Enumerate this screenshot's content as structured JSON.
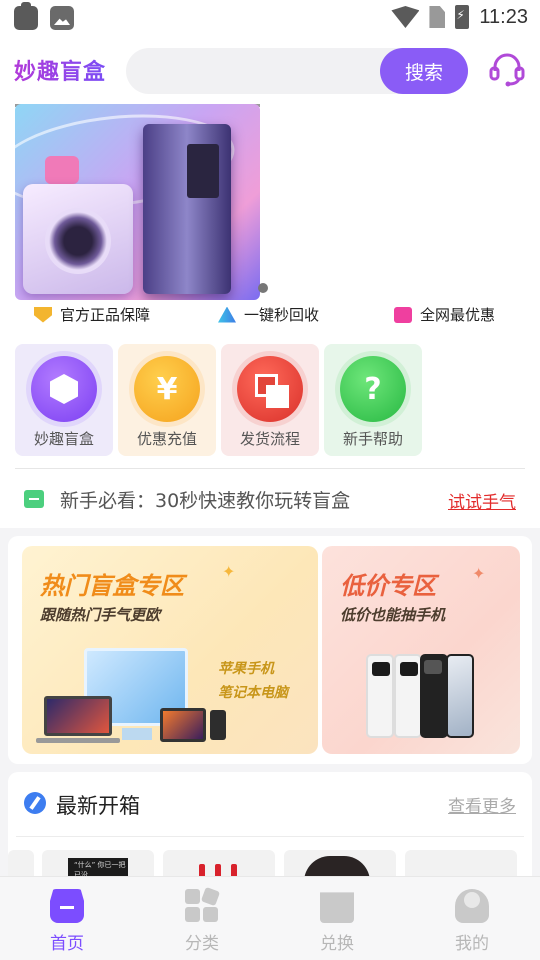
{
  "status_bar": {
    "time": "11:23"
  },
  "header": {
    "logo": "妙趣盲盒",
    "search": {
      "placeholder": "",
      "button_label": "搜索"
    }
  },
  "features": [
    "官方正品保障",
    "一键秒回收",
    "全网最优惠"
  ],
  "shortcuts": [
    {
      "label": "妙趣盲盒",
      "icon": "cube-icon",
      "glyph": ""
    },
    {
      "label": "优惠充值",
      "icon": "yen-icon",
      "glyph": "¥"
    },
    {
      "label": "发货流程",
      "icon": "squares-icon",
      "glyph": ""
    },
    {
      "label": "新手帮助",
      "icon": "question-icon",
      "glyph": "?"
    }
  ],
  "notice": {
    "text": "新手必看：30秒快速教你玩转盲盒",
    "link": "试试手气"
  },
  "promos": {
    "hot": {
      "title": "热门盲盒专区",
      "subtitle": "跟随热门手气更欧",
      "tag1": "苹果手机",
      "tag2": "笔记本电脑"
    },
    "cheap": {
      "title": "低价专区",
      "subtitle": "低价也能抽手机"
    }
  },
  "newest": {
    "title": "最新开箱",
    "more": "查看更多",
    "card1_text": "“什么” 你已一把已没"
  },
  "tabs": [
    {
      "label": "首页",
      "active": true
    },
    {
      "label": "分类",
      "active": false
    },
    {
      "label": "兑换",
      "active": false
    },
    {
      "label": "我的",
      "active": false
    }
  ],
  "colors": {
    "accent": "#7c4dff",
    "search_button": "#8a5cf6",
    "link": "#e22b2b"
  }
}
